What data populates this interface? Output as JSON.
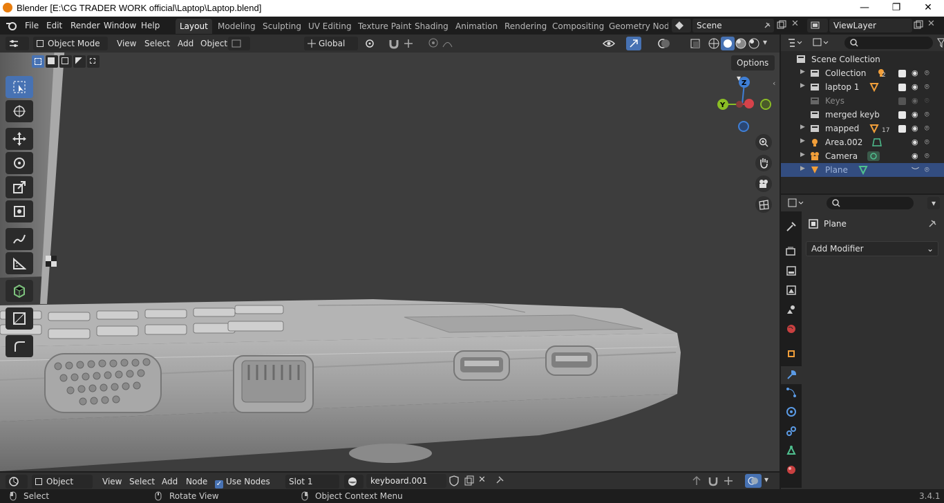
{
  "window": {
    "title": "Blender [E:\\CG TRADER WORK official\\Laptop\\Laptop.blend]",
    "minimize": "—",
    "maximize": "❐",
    "close": "✕"
  },
  "menus": [
    "File",
    "Edit",
    "Render",
    "Window",
    "Help"
  ],
  "workspaces": [
    "Layout",
    "Modeling",
    "Sculpting",
    "UV Editing",
    "Texture Paint",
    "Shading",
    "Animation",
    "Rendering",
    "Compositing",
    "Geometry Node"
  ],
  "active_workspace": "Layout",
  "scene": {
    "name": "Scene",
    "view_layer": "ViewLayer"
  },
  "viewport_header": {
    "mode": "Object Mode",
    "menu": [
      "View",
      "Select",
      "Add",
      "Object"
    ],
    "orientation": "Global",
    "options": "Options"
  },
  "gizmo": {
    "z": "Z",
    "y": "Y"
  },
  "outliner": {
    "root": "Scene Collection",
    "items": [
      {
        "name": "Collection",
        "checked": true,
        "badge": "2"
      },
      {
        "name": "laptop 1",
        "checked": true,
        "badge": ""
      },
      {
        "name": "Keys",
        "checked": false,
        "badge": ""
      },
      {
        "name": "merged keyb",
        "checked": true,
        "badge": ""
      },
      {
        "name": "mapped",
        "checked": true,
        "badge": "17"
      },
      {
        "name": "Area.002",
        "checked": null,
        "badge": ""
      },
      {
        "name": "Camera",
        "checked": null,
        "badge": ""
      },
      {
        "name": "Plane",
        "checked": null,
        "badge": "",
        "selected": true
      }
    ]
  },
  "properties": {
    "object_name": "Plane",
    "add_modifier": "Add Modifier"
  },
  "node_header": {
    "editor": "Object",
    "menu": [
      "View",
      "Select",
      "Add",
      "Node"
    ],
    "use_nodes": "Use Nodes",
    "slot": "Slot 1",
    "material": "keyboard.001"
  },
  "status": {
    "select": "Select",
    "rotate": "Rotate View",
    "context": "Object Context Menu",
    "version": "3.4.1"
  },
  "colors": {
    "accent": "#4772b3",
    "bg": "#1d1d1d",
    "viewport": "#3d3d3d",
    "header": "#303030",
    "x_axis": "#d6424a",
    "y_axis": "#8bbe25",
    "z_axis": "#3f7fd6"
  }
}
